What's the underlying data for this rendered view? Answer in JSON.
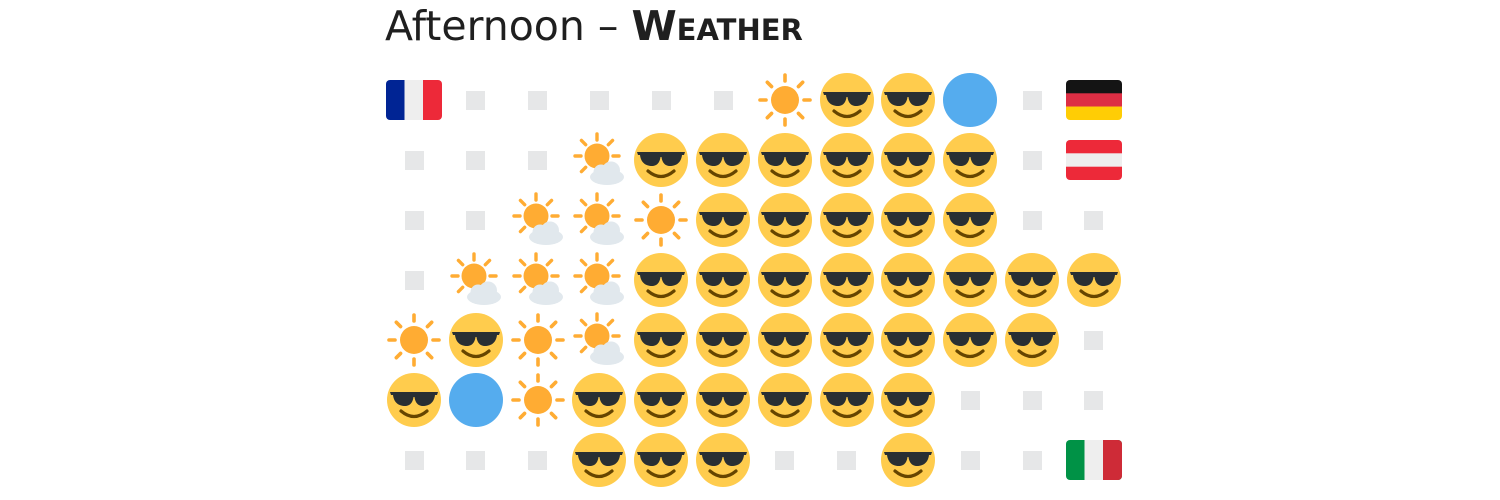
{
  "title": {
    "prefix": "Afternoon – ",
    "subject": "Weather"
  },
  "legend_icons": {
    "sunny": "sun-icon",
    "partly_cloudy": "sun-behind-cloud-icon",
    "hot": "smiling-face-with-sunglasses-icon",
    "rain": "blue-circle-icon",
    "no_data": "grey-square-icon"
  },
  "colors": {
    "sun": "#ffac33",
    "face": "#ffcc4d",
    "face_features": "#664500",
    "glasses": "#292f33",
    "cloud": "#e1e8ed",
    "rain": "#55acee",
    "empty": "#e6e7e8"
  },
  "flags": {
    "france": "flag-france-icon",
    "germany": "flag-germany-icon",
    "austria": "flag-austria-icon",
    "italy": "flag-italy-icon"
  },
  "grid": [
    [
      "flag:france",
      "empty",
      "empty",
      "empty",
      "empty",
      "empty",
      "sun",
      "cool",
      "cool",
      "rain",
      "empty",
      "flag:germany"
    ],
    [
      "empty",
      "empty",
      "empty",
      "sun_cloud",
      "cool",
      "cool",
      "cool",
      "cool",
      "cool",
      "cool",
      "empty",
      "flag:austria"
    ],
    [
      "empty",
      "empty",
      "sun_cloud",
      "sun_cloud",
      "sun",
      "cool",
      "cool",
      "cool",
      "cool",
      "cool",
      "empty",
      "empty"
    ],
    [
      "empty",
      "sun_cloud",
      "sun_cloud",
      "sun_cloud",
      "cool",
      "cool",
      "cool",
      "cool",
      "cool",
      "cool",
      "cool",
      "cool"
    ],
    [
      "sun",
      "cool",
      "sun",
      "sun_cloud",
      "cool",
      "cool",
      "cool",
      "cool",
      "cool",
      "cool",
      "cool",
      "empty"
    ],
    [
      "cool",
      "rain",
      "sun",
      "cool",
      "cool",
      "cool",
      "cool",
      "cool",
      "cool",
      "empty",
      "empty",
      "empty"
    ],
    [
      "empty",
      "empty",
      "empty",
      "cool",
      "cool",
      "cool",
      "empty",
      "empty",
      "cool",
      "empty",
      "empty",
      "flag:italy"
    ]
  ]
}
